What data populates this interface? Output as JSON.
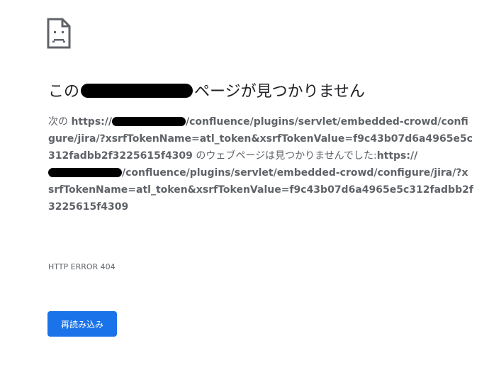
{
  "title": {
    "prefix": "この",
    "suffix": "ページが見つかりません"
  },
  "description": {
    "line_prefix": "次の",
    "url_scheme": "https://",
    "url_path": "/confluence/plugins/servlet/embedded-crowd/configure/jira/?xsrfTokenName=atl_token&xsrfTokenValue=f9c43b07d6a4965e5c312fadbb2f3225615f4309",
    "middle": " のウェブページは見つかりませんでした:",
    "url_scheme_2": "https://",
    "url_path_2": "/confluence/plugins/servlet/embedded-crowd/configure/jira/?xsrfTokenName=atl_token&xsrfTokenValue=f9c43b07d6a4965e5c312fadbb2f3225615f4309"
  },
  "error_code": "HTTP ERROR 404",
  "reload_button": {
    "label": "再読み込み"
  },
  "colors": {
    "button_background": "#1a73e8",
    "text": "#5f6368",
    "title": "#202124"
  },
  "icons": {
    "error": "sad-page-icon"
  }
}
